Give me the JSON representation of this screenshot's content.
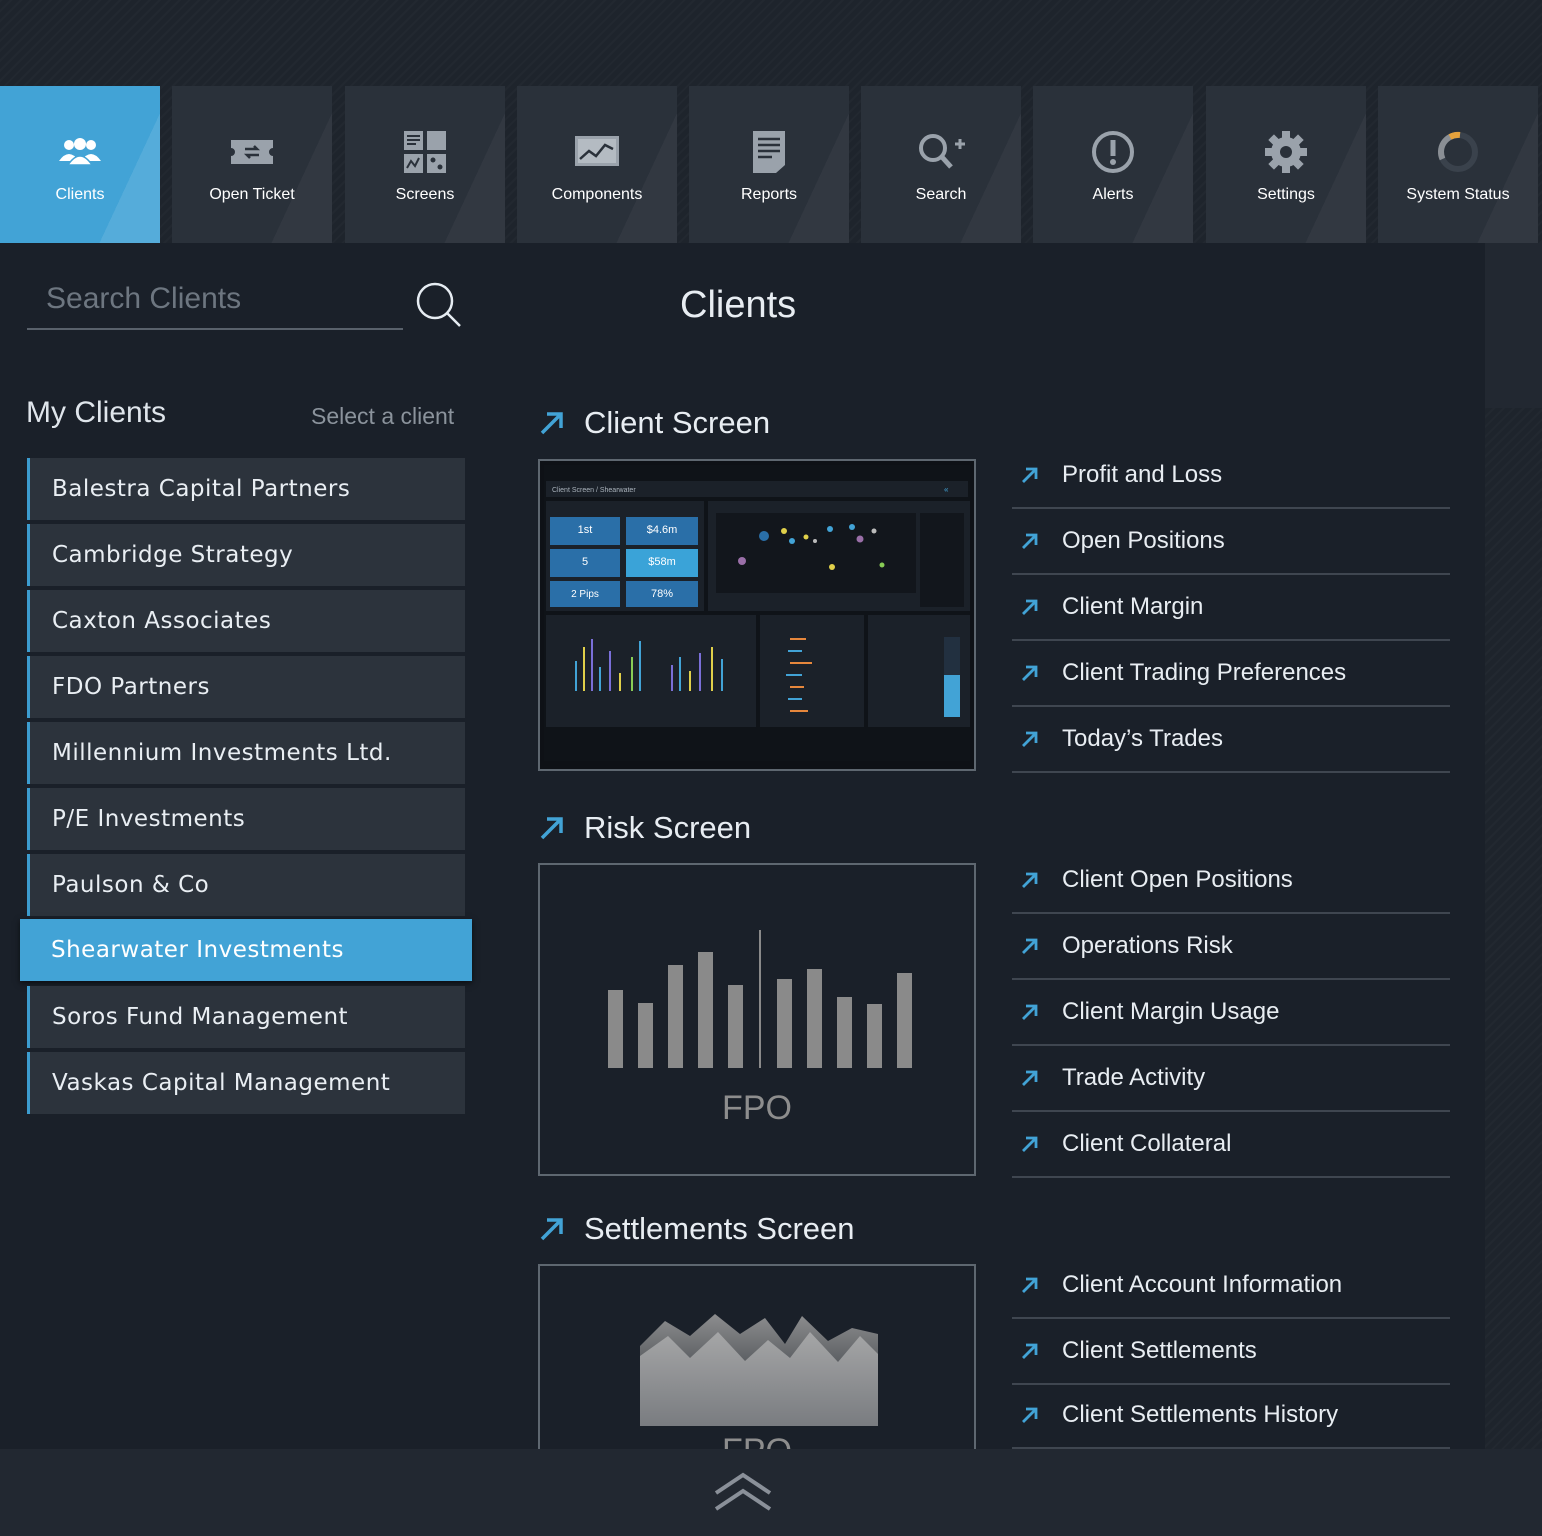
{
  "nav": {
    "items": [
      {
        "label": "Clients",
        "icon": "users-icon"
      },
      {
        "label": "Open Ticket",
        "icon": "ticket-icon"
      },
      {
        "label": "Screens",
        "icon": "screens-grid-icon"
      },
      {
        "label": "Components",
        "icon": "chart-monitor-icon"
      },
      {
        "label": "Reports",
        "icon": "document-icon"
      },
      {
        "label": "Search",
        "icon": "search-plus-icon"
      },
      {
        "label": "Alerts",
        "icon": "alert-icon"
      },
      {
        "label": "Settings",
        "icon": "gear-icon"
      },
      {
        "label": "System Status",
        "icon": "status-gauge-icon"
      }
    ],
    "active": "Clients"
  },
  "search": {
    "placeholder": "Search Clients"
  },
  "page": {
    "title": "Clients"
  },
  "sidebar": {
    "heading": "My Clients",
    "hint": "Select a client",
    "clients": [
      "Balestra Capital Partners",
      "Cambridge Strategy",
      "Caxton Associates",
      "FDO Partners",
      "Millennium Investments Ltd.",
      "P/E Investments",
      "Paulson & Co",
      "Shearwater Investments",
      "Soros Fund Management",
      "Vaskas Capital Management"
    ],
    "selected": "Shearwater Investments"
  },
  "sections": [
    {
      "title": "Client Screen",
      "links": [
        "Profit and Loss",
        "Open Positions",
        "Client Margin",
        "Client Trading Preferences",
        "Today’s Trades"
      ],
      "preview": {
        "breadcrumb": "Client Screen / Shearwater",
        "tiles": [
          "1st",
          "$4.6m",
          "5",
          "$58m",
          "2 Pips",
          "78%"
        ]
      }
    },
    {
      "title": "Risk Screen",
      "links": [
        "Client Open Positions",
        "Operations Risk",
        "Client Margin Usage",
        "Trade Activity",
        "Client Collateral"
      ],
      "placeholder": "FPO"
    },
    {
      "title": "Settlements Screen",
      "links": [
        "Client Account Information",
        "Client Settlements",
        "Client Settlements History"
      ],
      "placeholder": "FPO"
    }
  ],
  "colors": {
    "accent": "#42a3d6",
    "background": "#1a2029",
    "tile": "#2a313a",
    "client_row": "#2c333c",
    "text": "#e8edf2"
  }
}
